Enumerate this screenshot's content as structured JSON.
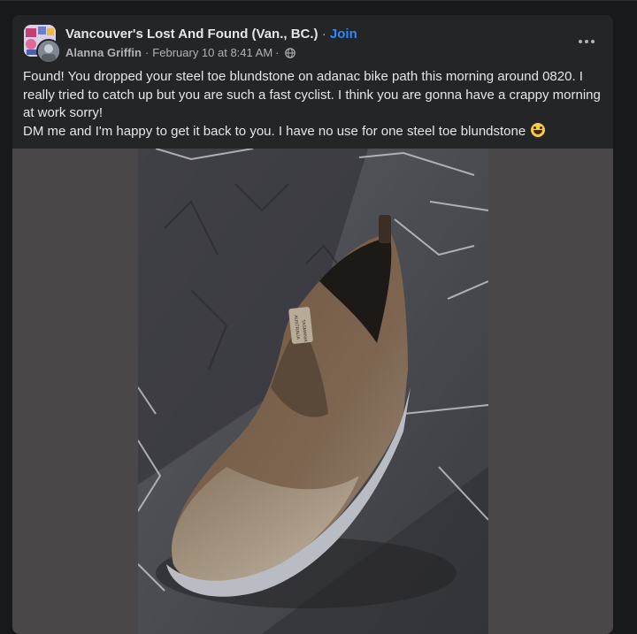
{
  "post": {
    "group_name": "Vancouver's Lost And Found (Van., BC.)",
    "separator": "·",
    "join_label": "Join",
    "author": "Alanna Griffin",
    "date": "February 10 at 8:41 AM",
    "audience_icon": "globe-icon",
    "more_icon": "more-options-icon",
    "paragraphs": [
      "Found! You dropped your steel toe blundstone on adanac bike path this morning around 0820. I really tried to catch up but you are such a fast cyclist. I think you are gonna have a crappy morning at work sorry!",
      "DM me and I'm happy to get it back to you. I have no use for one steel toe blundstone"
    ],
    "emoji": "laughing-face-emoji",
    "photo": {
      "description_icon": "boot-photo",
      "tag_text_1": "TASMANIA",
      "tag_text_2": "AUSTRALIA"
    }
  },
  "colors": {
    "background": "#18191a",
    "card": "#242526",
    "primary_text": "#e4e6eb",
    "secondary_text": "#b0b3b8",
    "link": "#2d88ff"
  }
}
